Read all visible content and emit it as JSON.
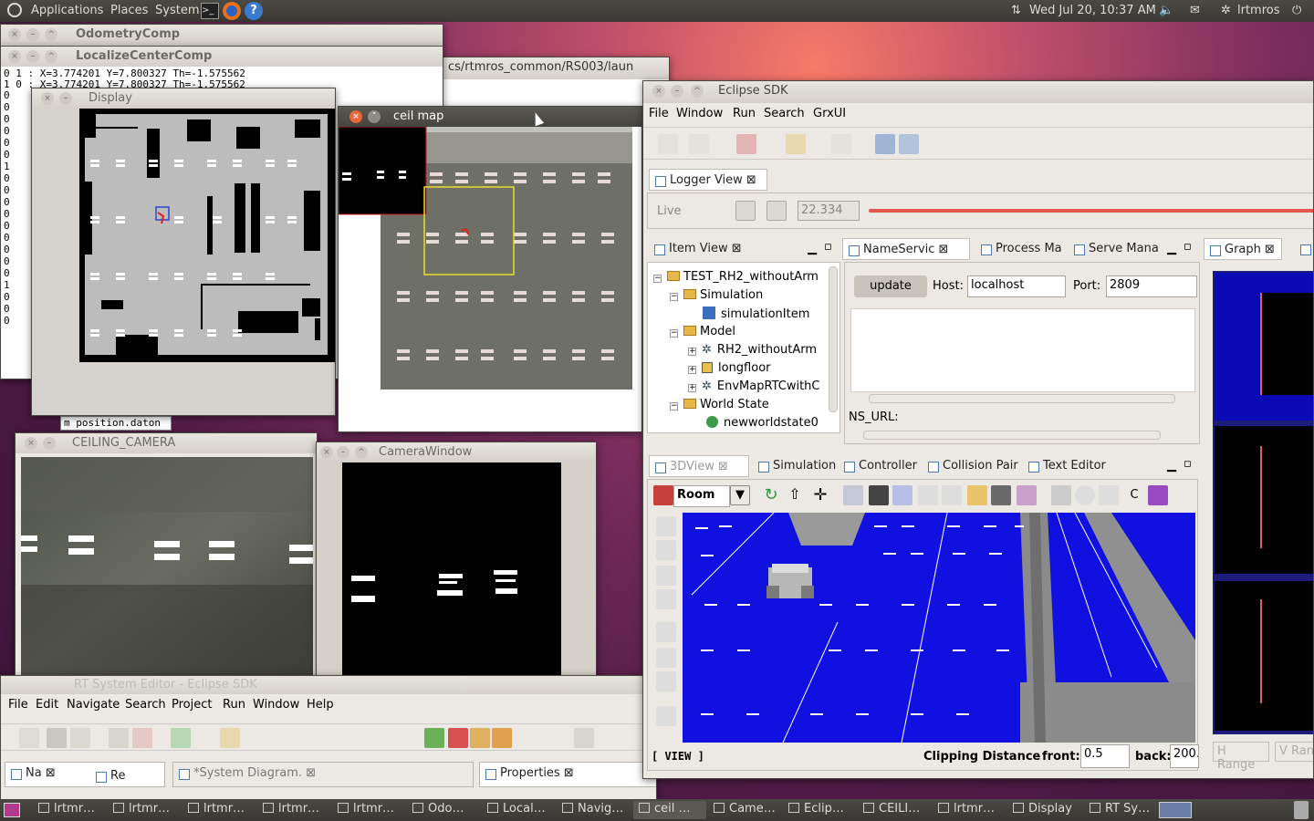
{
  "top_panel": {
    "applications": "Applications",
    "places": "Places",
    "system": "System",
    "datetime": "Wed Jul 20, 10:37 AM",
    "user": "lrtmros"
  },
  "odometry": {
    "title": "OdometryComp"
  },
  "localize": {
    "title": "LocalizeCenterComp",
    "line1": "0 1 : X=3.774201 Y=7.800327 Th=-1.575562",
    "line2": "1 0 : X=3.774201 Y=7.800327 Th=-1.575562",
    "left_col": [
      "0",
      "0",
      "0",
      "0",
      "0",
      "0",
      "1",
      "0",
      "0",
      "0",
      "0",
      "0",
      "0",
      "0",
      "0",
      "0",
      "1",
      "0",
      "0",
      "0"
    ]
  },
  "terminal": {
    "path": "cs/rtmros_common/RS003/laun",
    "bottom_text": "m position.dat",
    "bottom_suffix": "on"
  },
  "display": {
    "title": "Display"
  },
  "ceilmap": {
    "title": "ceil map"
  },
  "ceiling_camera": {
    "title": "CEILING_CAMERA"
  },
  "camera_window": {
    "title": "CameraWindow"
  },
  "eclipse": {
    "title": "Eclipse SDK",
    "menu": [
      "File",
      "Window",
      "Run",
      "Search",
      "GrxUI"
    ],
    "logger": {
      "tab": "Logger View",
      "live": "Live",
      "time": "22.334"
    },
    "itemview": {
      "tab": "Item View",
      "root": "TEST_RH2_withoutArm",
      "simulation": "Simulation",
      "simitem": "simulationItem",
      "model": "Model",
      "m1": "RH2_withoutArm",
      "m2": "longfloor",
      "m3": "EnvMapRTCwithC",
      "world": "World State",
      "ws1": "newworldstate0"
    },
    "nameservice": {
      "tab": "NameServic",
      "tab2": "Process Ma",
      "tab3": "Serve Mana",
      "update": "update",
      "host_label": "Host:",
      "host": "localhost",
      "port_label": "Port:",
      "port": "2809",
      "nsurl": "NS_URL:"
    },
    "graph": {
      "tab": "Graph",
      "hrange": "H Range",
      "vrange": "V Rang"
    },
    "view3d": {
      "tab": "3DView",
      "tab2": "Simulation",
      "tab3": "Controller",
      "tab4": "Collision Pair",
      "tab5": "Text Editor",
      "room": "Room",
      "c": "C",
      "status": "[ VIEW ]",
      "clipping": "Clipping Distance",
      "front_label": "front:",
      "front": "0.5",
      "back_label": "back:",
      "back": "200.0"
    }
  },
  "rtse": {
    "title": "RT System Editor - Eclipse SDK",
    "menu": [
      "File",
      "Edit",
      "Navigate",
      "Search",
      "Project",
      "Run",
      "Window",
      "Help"
    ],
    "tab1": "Na",
    "tab2": "Re",
    "tab3": "*System Diagram.",
    "tab4": "Properties"
  },
  "taskbar": [
    "lrtmr…",
    "lrtmr…",
    "lrtmr…",
    "lrtmr…",
    "lrtmr…",
    "Odo…",
    "Local…",
    "Navig…",
    "ceil …",
    "Came…",
    "Eclip…",
    "CEILI…",
    "lrtmr…",
    "Display",
    "RT Sy…"
  ]
}
